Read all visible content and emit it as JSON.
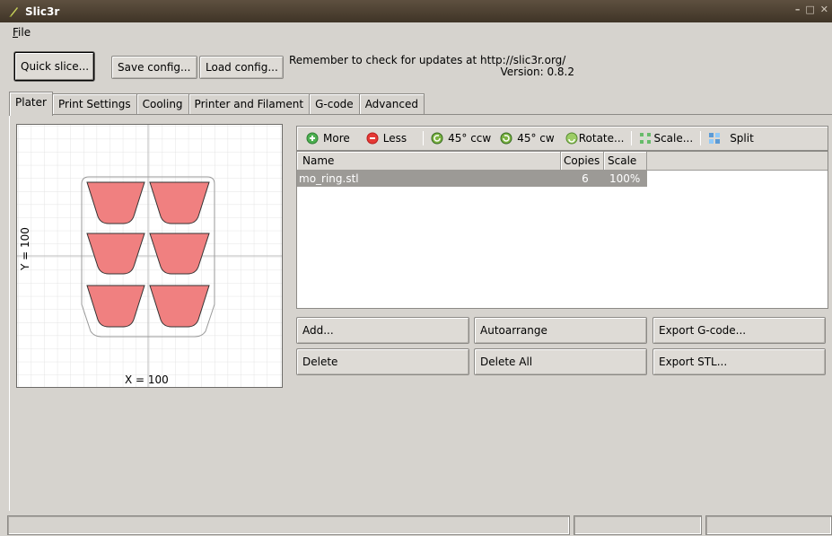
{
  "window": {
    "title": "Slic3r",
    "controls": [
      "–",
      "□",
      "✕"
    ]
  },
  "menu": {
    "items": [
      {
        "label": "File",
        "accel": "F",
        "rest": "ile"
      }
    ]
  },
  "top_buttons": {
    "quick_slice": "Quick slice...",
    "save_config": "Save config...",
    "load_config": "Load config..."
  },
  "notice": {
    "line1": "Remember to check for updates at http://slic3r.org/",
    "line2": "Version: 0.8.2"
  },
  "tabs": [
    "Plater",
    "Print Settings",
    "Cooling",
    "Printer and Filament",
    "G-code",
    "Advanced"
  ],
  "active_tab": "Plater",
  "plater": {
    "x_label": "X = 100",
    "y_label": "Y = 100",
    "part_color": "#f08080"
  },
  "toolbar": {
    "more": "More",
    "less": "Less",
    "rotate_ccw": "45° ccw",
    "rotate_cw": "45° cw",
    "rotate": "Rotate...",
    "scale": "Scale...",
    "split": "Split"
  },
  "object_list": {
    "columns": [
      "Name",
      "Copies",
      "Scale"
    ],
    "rows": [
      {
        "name": "mo_ring.stl",
        "copies": "6",
        "scale": "100%"
      }
    ]
  },
  "actions": {
    "add": "Add...",
    "autoarrange": "Autoarrange",
    "export_gcode": "Export G-code...",
    "delete": "Delete",
    "delete_all": "Delete All",
    "export_stl": "Export STL..."
  },
  "colors": {
    "titlebar": "#4e4234",
    "window_bg": "#d6d3ce",
    "selection": "#9c9a96",
    "part": "#f08080"
  }
}
